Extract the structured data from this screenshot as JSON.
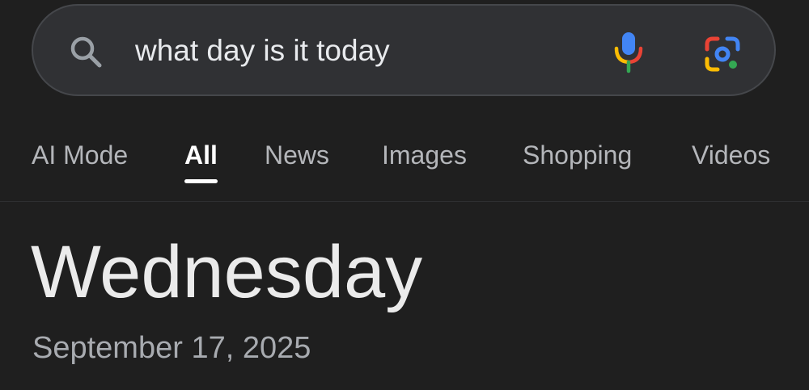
{
  "search": {
    "query": "what day is it today",
    "search_icon": "search-icon",
    "mic_icon": "microphone-icon",
    "lens_icon": "google-lens-icon"
  },
  "tabs": [
    {
      "label": "AI Mode",
      "active": false
    },
    {
      "label": "All",
      "active": true
    },
    {
      "label": "News",
      "active": false
    },
    {
      "label": "Images",
      "active": false
    },
    {
      "label": "Shopping",
      "active": false
    },
    {
      "label": "Videos",
      "active": false
    }
  ],
  "result": {
    "day": "Wednesday",
    "date": "September 17, 2025"
  },
  "colors": {
    "background": "#1f1f1f",
    "search_bar": "#303134",
    "text_primary": "#e8eaed",
    "text_secondary": "#a8abb0",
    "google_blue": "#4285f4",
    "google_red": "#ea4335",
    "google_yellow": "#fbbc04",
    "google_green": "#34a853"
  }
}
